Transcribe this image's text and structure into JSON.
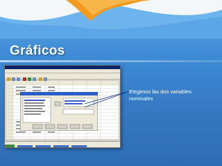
{
  "slide": {
    "title": "Gráficos",
    "note": "Elegimos las dos variables nominales",
    "colors": {
      "background": "#3d8ad4",
      "swirl_orange": "#f29b1d",
      "swirl_white": "#f4f7fa",
      "text": "#ffffff"
    }
  },
  "screenshot": {
    "icon": "spss-data-editor-screenshot",
    "dialog_icon": "chart-builder-dialog"
  }
}
